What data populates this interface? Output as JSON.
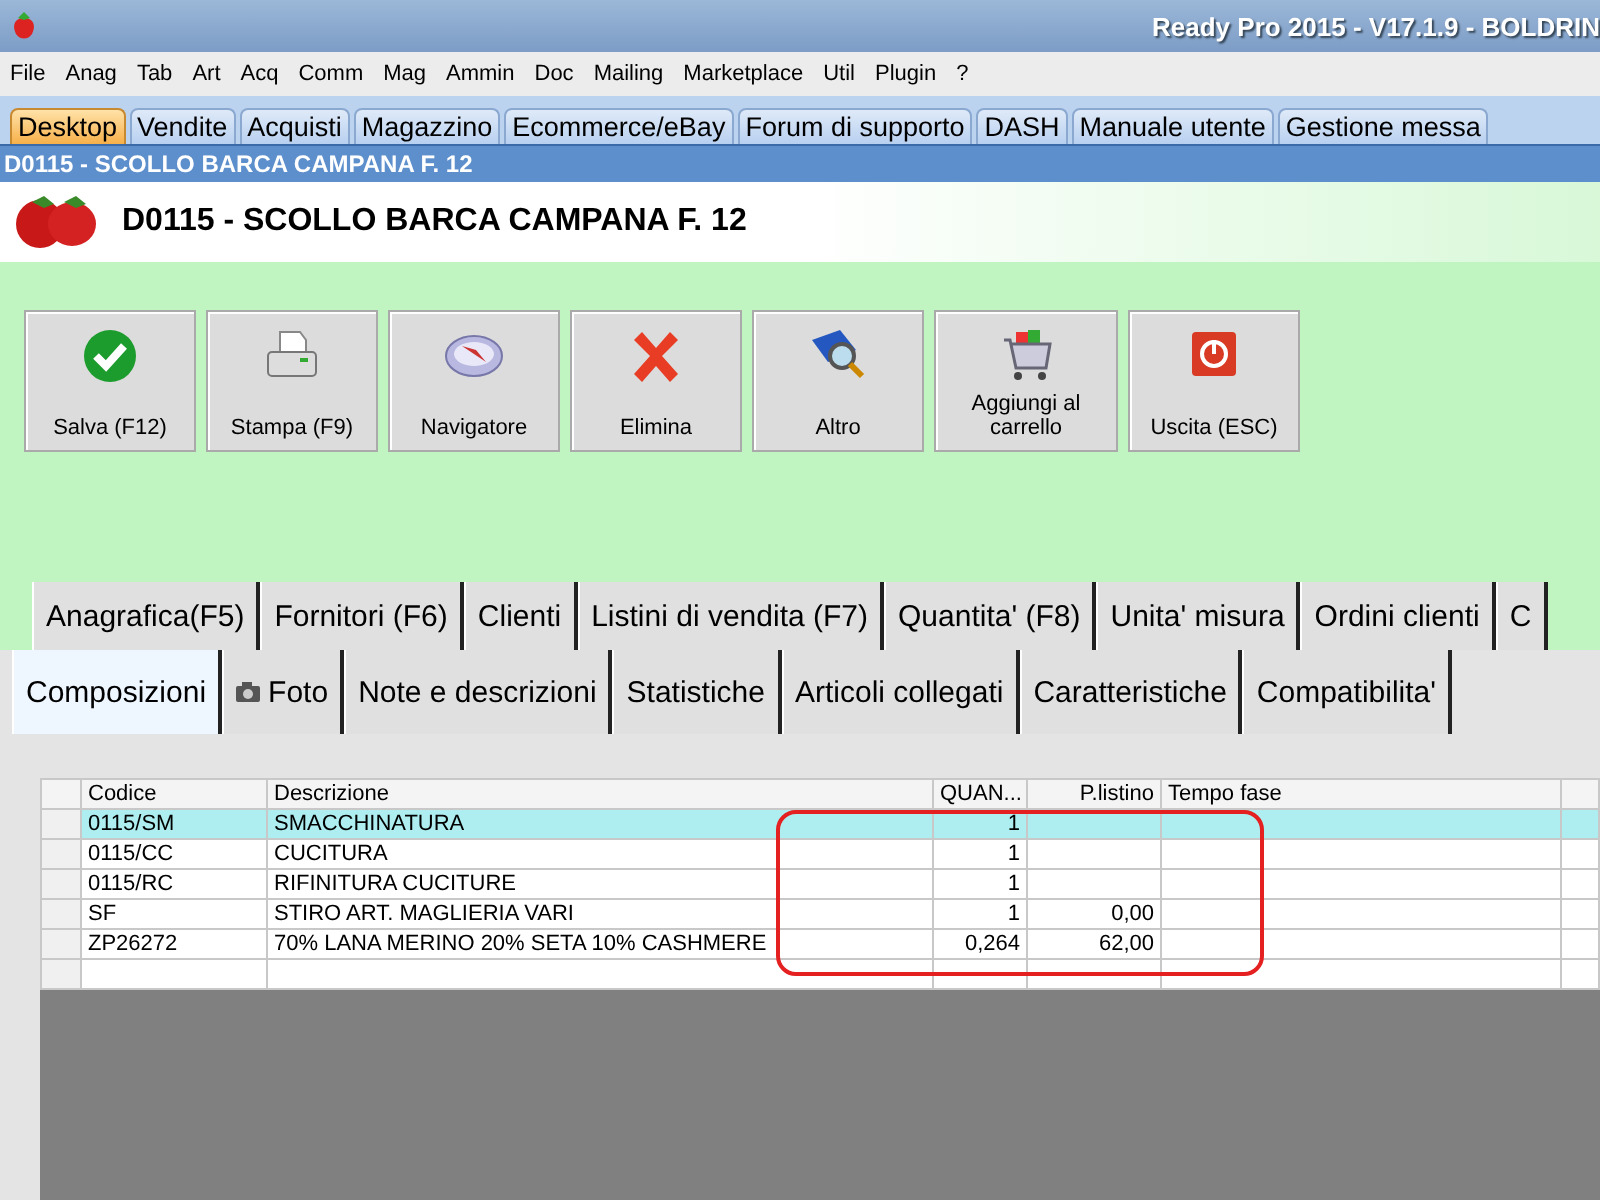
{
  "window": {
    "title": "Ready Pro 2015 - V17.1.9 - BOLDRIN"
  },
  "menu": [
    "File",
    "Anag",
    "Tab",
    "Art",
    "Acq",
    "Comm",
    "Mag",
    "Ammin",
    "Doc",
    "Mailing",
    "Marketplace",
    "Util",
    "Plugin",
    "?"
  ],
  "main_tabs": [
    {
      "label": "Desktop",
      "selected": true
    },
    {
      "label": "Vendite",
      "selected": false
    },
    {
      "label": "Acquisti",
      "selected": false
    },
    {
      "label": "Magazzino",
      "selected": false
    },
    {
      "label": "Ecommerce/eBay",
      "selected": false
    },
    {
      "label": "Forum di supporto",
      "selected": false
    },
    {
      "label": "DASH",
      "selected": false
    },
    {
      "label": "Manuale utente",
      "selected": false
    },
    {
      "label": "Gestione messa",
      "selected": false
    }
  ],
  "document_bar": "D0115 - SCOLLO BARCA CAMPANA F. 12",
  "header_title": "D0115 - SCOLLO BARCA CAMPANA F. 12",
  "toolbar": [
    {
      "label": "Salva (F12)",
      "kind": "save"
    },
    {
      "label": "Stampa (F9)",
      "kind": "print"
    },
    {
      "label": "Navigatore",
      "kind": "compass"
    },
    {
      "label": "Elimina",
      "kind": "delete"
    },
    {
      "label": "Altro",
      "kind": "book"
    },
    {
      "label": "Aggiungi al carrello",
      "kind": "cart"
    },
    {
      "label": "Uscita (ESC)",
      "kind": "exit"
    }
  ],
  "tabs_row_1": [
    {
      "label": "Anagrafica(F5)",
      "selected": false
    },
    {
      "label": "Fornitori (F6)",
      "selected": false
    },
    {
      "label": "Clienti",
      "selected": false
    },
    {
      "label": "Listini di vendita (F7)",
      "selected": false
    },
    {
      "label": "Quantita' (F8)",
      "selected": false
    },
    {
      "label": "Unita' misura",
      "selected": false
    },
    {
      "label": "Ordini clienti",
      "selected": false
    },
    {
      "label": "C",
      "selected": false
    }
  ],
  "tabs_row_2": [
    {
      "label": "Composizioni",
      "selected": true
    },
    {
      "label": "Foto",
      "selected": false,
      "kind": "camera"
    },
    {
      "label": "Note e descrizioni",
      "selected": false
    },
    {
      "label": "Statistiche",
      "selected": false
    },
    {
      "label": "Articoli collegati",
      "selected": false
    },
    {
      "label": "Caratteristiche",
      "selected": false
    },
    {
      "label": "Compatibilita'",
      "selected": false
    }
  ],
  "table": {
    "columns": [
      "Codice",
      "Descrizione",
      "QUAN...",
      "P.listino",
      "Tempo   fase"
    ],
    "rows": [
      {
        "cells": [
          "0115/SM",
          "SMACCHINATURA",
          "1",
          ""
        ],
        "selected": true
      },
      {
        "cells": [
          "0115/CC",
          "CUCITURA",
          "1",
          ""
        ],
        "selected": false
      },
      {
        "cells": [
          "0115/RC",
          "RIFINITURA CUCITURE",
          "1",
          ""
        ],
        "selected": false
      },
      {
        "cells": [
          "SF",
          "STIRO ART. MAGLIERIA VARI",
          "1",
          "0,00"
        ],
        "selected": false
      },
      {
        "cells": [
          "ZP26272",
          "70% LANA MERINO 20% SETA 10% CASHMERE",
          "0,264",
          "62,00"
        ],
        "selected": false
      }
    ]
  }
}
